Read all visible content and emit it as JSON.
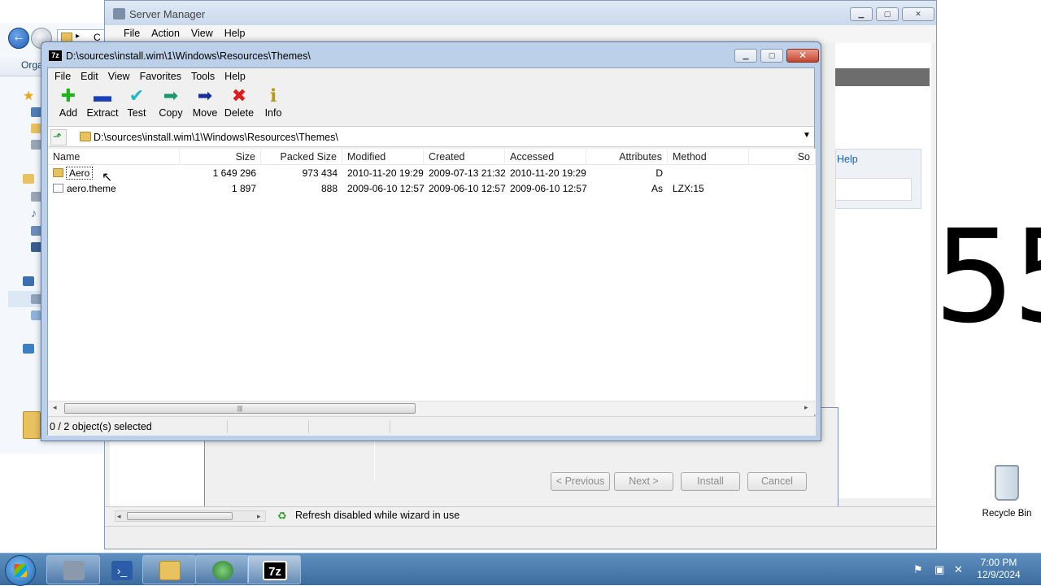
{
  "explorer": {
    "toolbar_label": "Orga",
    "address_label": "C"
  },
  "server_manager": {
    "title": "Server Manager",
    "menu": [
      "File",
      "Action",
      "View",
      "Help"
    ],
    "help_link": "Help",
    "wizard_buttons": {
      "previous": "< Previous",
      "next": "Next >",
      "install": "Install",
      "cancel": "Cancel"
    },
    "status_text": "Refresh disabled while wizard in use"
  },
  "background_digits": "55",
  "sevenzip": {
    "title": "D:\\sources\\install.wim\\1\\Windows\\Resources\\Themes\\",
    "app_icon_text": "7z",
    "menu": [
      "File",
      "Edit",
      "View",
      "Favorites",
      "Tools",
      "Help"
    ],
    "toolbar": [
      {
        "label": "Add",
        "icon": "plus-icon",
        "color": "#1db31d",
        "glyph": "✚"
      },
      {
        "label": "Extract",
        "icon": "minus-icon",
        "color": "#1b3fb8",
        "glyph": "▬"
      },
      {
        "label": "Test",
        "icon": "check-icon",
        "color": "#1fb8c7",
        "glyph": "✔"
      },
      {
        "label": "Copy",
        "icon": "arrow-right-copy-icon",
        "color": "#1a9a6c",
        "glyph": "➡"
      },
      {
        "label": "Move",
        "icon": "arrow-right-move-icon",
        "color": "#1a2f9a",
        "glyph": "➡"
      },
      {
        "label": "Delete",
        "icon": "x-icon",
        "color": "#e01b1b",
        "glyph": "✖"
      },
      {
        "label": "Info",
        "icon": "info-icon",
        "color": "#b59a12",
        "glyph": "ℹ"
      }
    ],
    "path": "D:\\sources\\install.wim\\1\\Windows\\Resources\\Themes\\",
    "columns": [
      "Name",
      "Size",
      "Packed Size",
      "Modified",
      "Created",
      "Accessed",
      "Attributes",
      "Method",
      "So"
    ],
    "rows": [
      {
        "name": "Aero",
        "type": "folder",
        "size": "1 649 296",
        "packed": "973 434",
        "modified": "2010-11-20 19:29",
        "created": "2009-07-13 21:32",
        "accessed": "2010-11-20 19:29",
        "attributes": "D",
        "method": ""
      },
      {
        "name": "aero.theme",
        "type": "file",
        "size": "1 897",
        "packed": "888",
        "modified": "2009-06-10 12:57",
        "created": "2009-06-10 12:57",
        "accessed": "2009-06-10 12:57",
        "attributes": "As",
        "method": "LZX:15"
      }
    ],
    "status": "0 / 2 object(s) selected"
  },
  "desktop": {
    "recycle_bin_label": "Recycle Bin"
  },
  "taskbar": {
    "time": "7:00 PM",
    "date": "12/9/2024",
    "sevenzip_task_text": "7z"
  }
}
